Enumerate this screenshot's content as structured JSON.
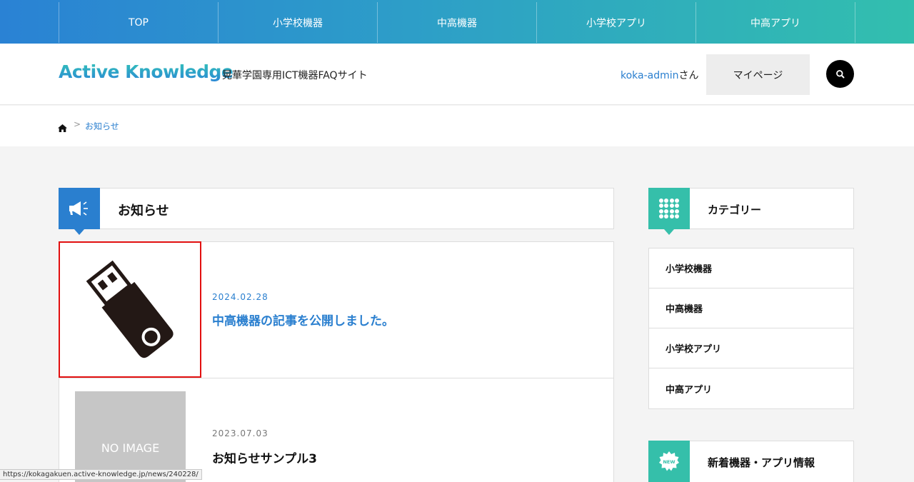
{
  "nav": {
    "items": [
      {
        "label": "TOP"
      },
      {
        "label": "小学校機器"
      },
      {
        "label": "中高機器"
      },
      {
        "label": "小学校アプリ"
      },
      {
        "label": "中高アプリ"
      }
    ]
  },
  "header": {
    "logo": "Active Knowledge",
    "tagline": "晃華学園専用ICT機器FAQサイト",
    "user_name": "koka-admin",
    "user_suffix": "さん",
    "mypage_label": "マイページ",
    "search_icon": "search-icon"
  },
  "breadcrumb": {
    "home_icon": "home-icon",
    "separator": ">",
    "current": "お知らせ"
  },
  "news": {
    "title": "お知らせ",
    "icon": "megaphone-icon",
    "articles": [
      {
        "date": "2024.02.28",
        "title": "中高機器の記事を公開しました。",
        "thumb_icon": "usb-drive-icon"
      },
      {
        "date": "2023.07.03",
        "title": "お知らせサンプル3",
        "thumb_text": "NO IMAGE"
      }
    ]
  },
  "sidebar": {
    "category_title": "カテゴリー",
    "category_icon": "grid-icon",
    "categories": [
      {
        "label": "小学校機器"
      },
      {
        "label": "中高機器"
      },
      {
        "label": "小学校アプリ"
      },
      {
        "label": "中高アプリ"
      }
    ],
    "new_title": "新着機器・アプリ情報",
    "new_icon": "new-badge-icon",
    "new_badge_text": "NEW"
  },
  "statusbar": {
    "url": "https://kokagakuen.active-knowledge.jp/news/240228/"
  },
  "colors": {
    "accent_blue": "#2a7fcf",
    "accent_teal": "#35bfaa",
    "highlight_red": "#e21010"
  }
}
